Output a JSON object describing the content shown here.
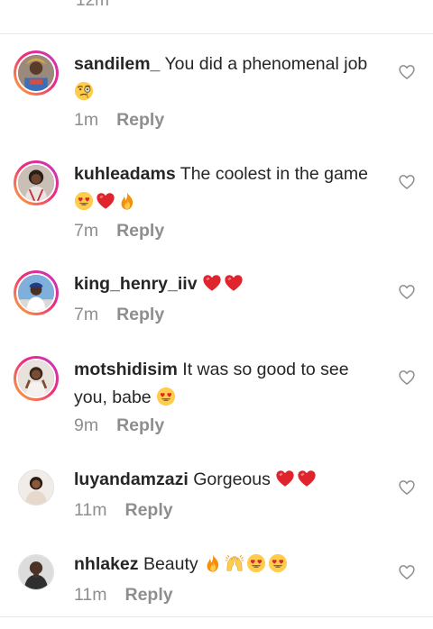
{
  "top_partial": "12m",
  "comments": [
    {
      "username": "sandilem_",
      "text": "You did a phenomenal job",
      "time": "1m",
      "reply": "Reply"
    },
    {
      "username": "kuhleadams",
      "text": "The coolest in the game",
      "time": "7m",
      "reply": "Reply"
    },
    {
      "username": "king_henry_iiv",
      "text": "",
      "time": "7m",
      "reply": "Reply"
    },
    {
      "username": "motshidisim",
      "text": "It was so good to see you, babe",
      "time": "9m",
      "reply": "Reply"
    },
    {
      "username": "luyandamzazi",
      "text": "Gorgeous",
      "time": "11m",
      "reply": "Reply"
    },
    {
      "username": "nhlakez",
      "text": "Beauty",
      "time": "11m",
      "reply": "Reply"
    }
  ],
  "icons": {
    "like": "heart-outline-icon",
    "emojis": [
      "monocle-face-emoji",
      "heart-eyes-emoji",
      "red-heart-emoji",
      "fire-emoji",
      "raised-hands-emoji"
    ]
  },
  "colors": {
    "text": "#262626",
    "secondary": "#8e8e8e",
    "heart": "#e0242e",
    "story_ring": "#ee2a7b"
  }
}
